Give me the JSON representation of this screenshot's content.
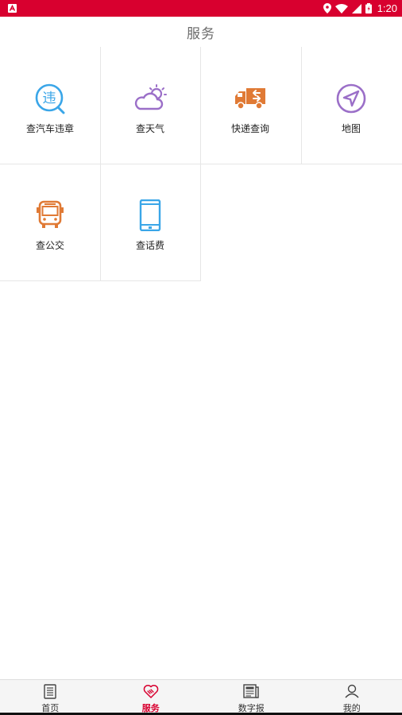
{
  "status_bar": {
    "time": "1:20",
    "icons": [
      "notification-a-icon",
      "location-icon",
      "wifi-icon",
      "signal-icon",
      "battery-icon"
    ],
    "bg_color": "#d8002f"
  },
  "header": {
    "title": "服务"
  },
  "services": [
    {
      "label": "查汽车违章",
      "icon": "car-violation-icon",
      "color": "#3aa6e8"
    },
    {
      "label": "查天气",
      "icon": "weather-icon",
      "color": "#9b6fc8"
    },
    {
      "label": "快递查询",
      "icon": "delivery-truck-icon",
      "color": "#e07a35"
    },
    {
      "label": "地图",
      "icon": "map-navigation-icon",
      "color": "#9b6fc8"
    },
    {
      "label": "查公交",
      "icon": "bus-icon",
      "color": "#e07a35"
    },
    {
      "label": "查话费",
      "icon": "phone-bill-icon",
      "color": "#3aa6e8"
    }
  ],
  "bottom_nav": {
    "active_color": "#d8002f",
    "items": [
      {
        "label": "首页",
        "icon": "home-news-icon",
        "active": false
      },
      {
        "label": "服务",
        "icon": "service-handshake-icon",
        "active": true
      },
      {
        "label": "数字报",
        "icon": "newspaper-icon",
        "active": false
      },
      {
        "label": "我的",
        "icon": "user-icon",
        "active": false
      }
    ]
  }
}
